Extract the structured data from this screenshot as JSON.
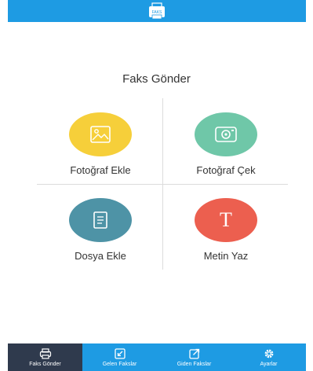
{
  "header": {
    "logo_icon": "fax-machine-icon",
    "logo_text": "FAKS"
  },
  "main": {
    "title": "Faks Gönder",
    "actions": [
      {
        "label": "Fotoğraf Ekle",
        "icon": "image-icon",
        "color": "#f6cf3a"
      },
      {
        "label": "Fotoğraf Çek",
        "icon": "camera-icon",
        "color": "#6fc7a8"
      },
      {
        "label": "Dosya Ekle",
        "icon": "document-icon",
        "color": "#4e93a6"
      },
      {
        "label": "Metin Yaz",
        "icon": "text-icon",
        "color": "#ec5f4f",
        "glyph": "T"
      }
    ]
  },
  "tabbar": {
    "tabs": [
      {
        "label": "Faks Gönder",
        "icon": "fax-icon",
        "active": true
      },
      {
        "label": "Gelen Fakslar",
        "icon": "incoming-icon",
        "active": false
      },
      {
        "label": "Giden Fakslar",
        "icon": "outgoing-icon",
        "active": false
      },
      {
        "label": "Ayarlar",
        "icon": "gear-icon",
        "active": false
      }
    ]
  },
  "colors": {
    "primary": "#1e9be3",
    "active_tab": "#2f3a4d",
    "text": "#333333"
  }
}
